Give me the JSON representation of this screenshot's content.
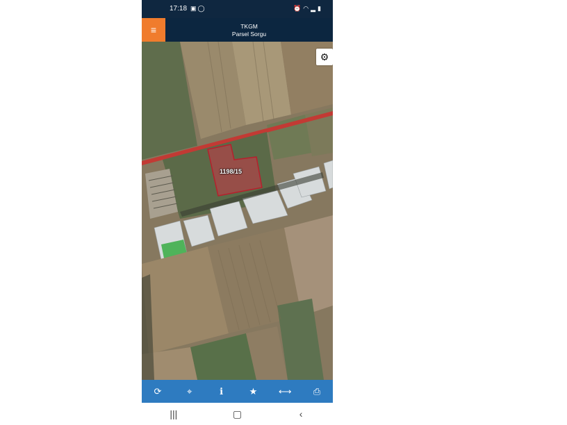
{
  "status": {
    "time": "17:18",
    "left_icons": [
      "image-icon",
      "whatsapp-icon"
    ],
    "right_icons": [
      "alarm-icon",
      "wifi-icon",
      "signal-icon",
      "battery-icon"
    ]
  },
  "header": {
    "title": "TKGM",
    "subtitle": "Parsel Sorgu"
  },
  "map": {
    "parcel_label": "1198/15",
    "parcel_color": "#c0182a"
  },
  "toolbar": {
    "items": [
      "refresh-icon",
      "locate-icon",
      "info-icon",
      "star-icon",
      "measure-icon",
      "print-icon"
    ]
  },
  "navbar": {
    "items": [
      "recents-icon",
      "home-icon",
      "back-icon"
    ]
  },
  "colors": {
    "header_bg": "#0c2640",
    "menu_accent": "#f07c2d",
    "toolbar_bg": "#2e7bc0"
  }
}
